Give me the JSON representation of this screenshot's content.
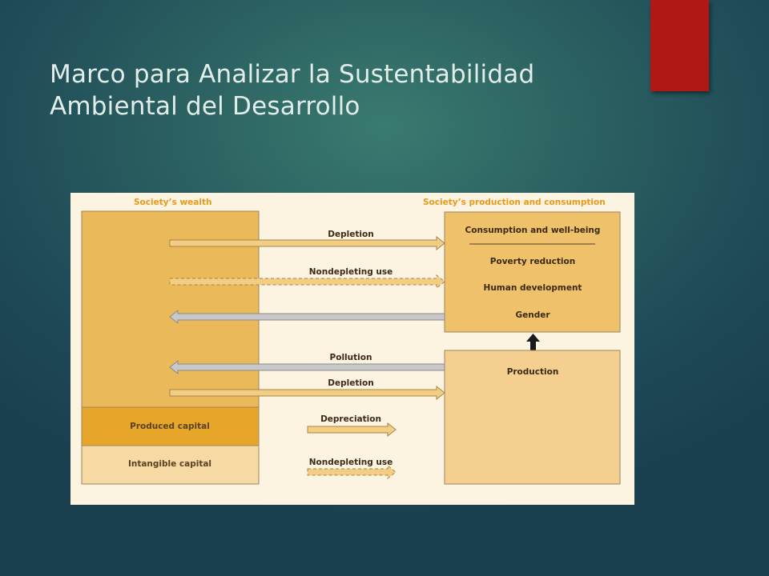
{
  "slide": {
    "title_line1": "Marco para Analizar la Sustentabilidad",
    "title_line2": "Ambiental del Desarrollo",
    "accent_color": "#b01816"
  },
  "diagram": {
    "left_header": "Society’s wealth",
    "right_header": "Society’s production and consumption",
    "wealth_boxes": {
      "produced_capital": "Produced capital",
      "intangible_capital": "Intangible capital"
    },
    "consumption_box": {
      "title": "Consumption and well-being",
      "items": [
        "Poverty reduction",
        "Human development",
        "Gender"
      ]
    },
    "production_box": {
      "title": "Production"
    },
    "arrows": {
      "depletion_top": "Depletion",
      "nondepleting_top": "Nondepleting use",
      "pollution": "Pollution",
      "depletion_bottom": "Depletion",
      "depreciation": "Depreciation",
      "nondepleting_bottom": "Nondepleting use"
    },
    "colors": {
      "background": "#fdf3e1",
      "header_text": "#e39a1f",
      "natural_capital": "#eab95a",
      "produced_capital": "#e6a62a",
      "intangible_capital": "#f6d9a3",
      "consumption": "#eec16a",
      "production": "#f4cf8f",
      "return_arrow": "#c8c8c8"
    }
  }
}
